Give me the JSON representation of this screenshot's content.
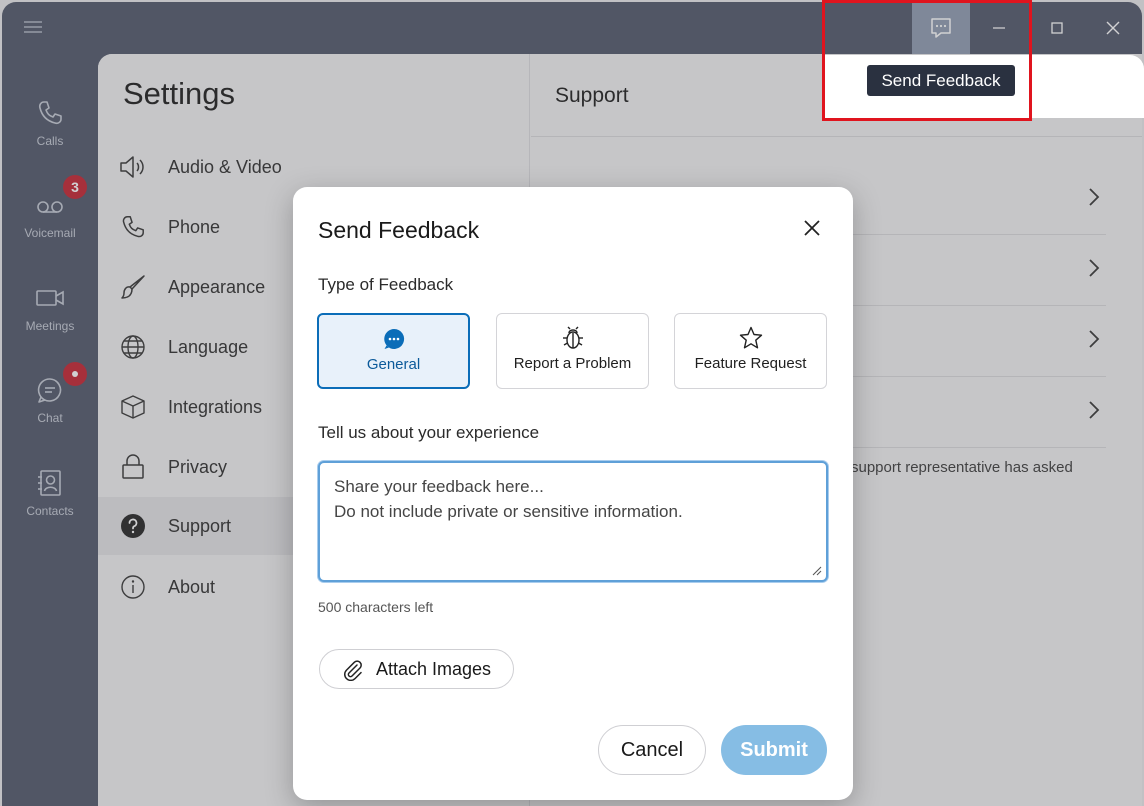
{
  "titlebar": {
    "menu_icon": "hamburger-icon",
    "controls": [
      "feedback-icon",
      "minimize-icon",
      "maximize-icon",
      "close-icon"
    ]
  },
  "tooltip": {
    "text": "Send Feedback"
  },
  "rail": {
    "items": [
      {
        "label": "Calls",
        "icon": "phone-icon"
      },
      {
        "label": "Voicemail",
        "icon": "voicemail-icon",
        "badge": "3"
      },
      {
        "label": "Meetings",
        "icon": "video-icon"
      },
      {
        "label": "Chat",
        "icon": "chat-icon",
        "dot": true
      },
      {
        "label": "Contacts",
        "icon": "contacts-icon"
      }
    ]
  },
  "settings": {
    "title": "Settings",
    "items": [
      {
        "label": "Audio & Video",
        "icon": "speaker-icon"
      },
      {
        "label": "Phone",
        "icon": "phone-icon"
      },
      {
        "label": "Appearance",
        "icon": "brush-icon"
      },
      {
        "label": "Language",
        "icon": "globe-icon"
      },
      {
        "label": "Integrations",
        "icon": "cube-icon"
      },
      {
        "label": "Privacy",
        "icon": "lock-icon"
      },
      {
        "label": "Support",
        "icon": "help-icon",
        "active": true
      },
      {
        "label": "About",
        "icon": "info-icon"
      }
    ]
  },
  "support": {
    "title": "Support",
    "note": "support representative has asked"
  },
  "modal": {
    "title": "Send Feedback",
    "type_label": "Type of Feedback",
    "types": [
      {
        "label": "General",
        "icon": "chat-bubble-icon",
        "selected": true
      },
      {
        "label": "Report a Problem",
        "icon": "bug-icon"
      },
      {
        "label": "Feature Request",
        "icon": "star-icon"
      }
    ],
    "experience_label": "Tell us about your experience",
    "placeholder": "Share your feedback here...\nDo not include private or sensitive information.",
    "chars_left": "500 characters left",
    "attach_label": "Attach Images",
    "cancel_label": "Cancel",
    "submit_label": "Submit"
  },
  "colors": {
    "rail_bg": "#4e5568",
    "accent": "#0b6db8",
    "badge": "#c4202f",
    "submit_disabled": "#86bde4",
    "highlight": "#e0141e"
  }
}
